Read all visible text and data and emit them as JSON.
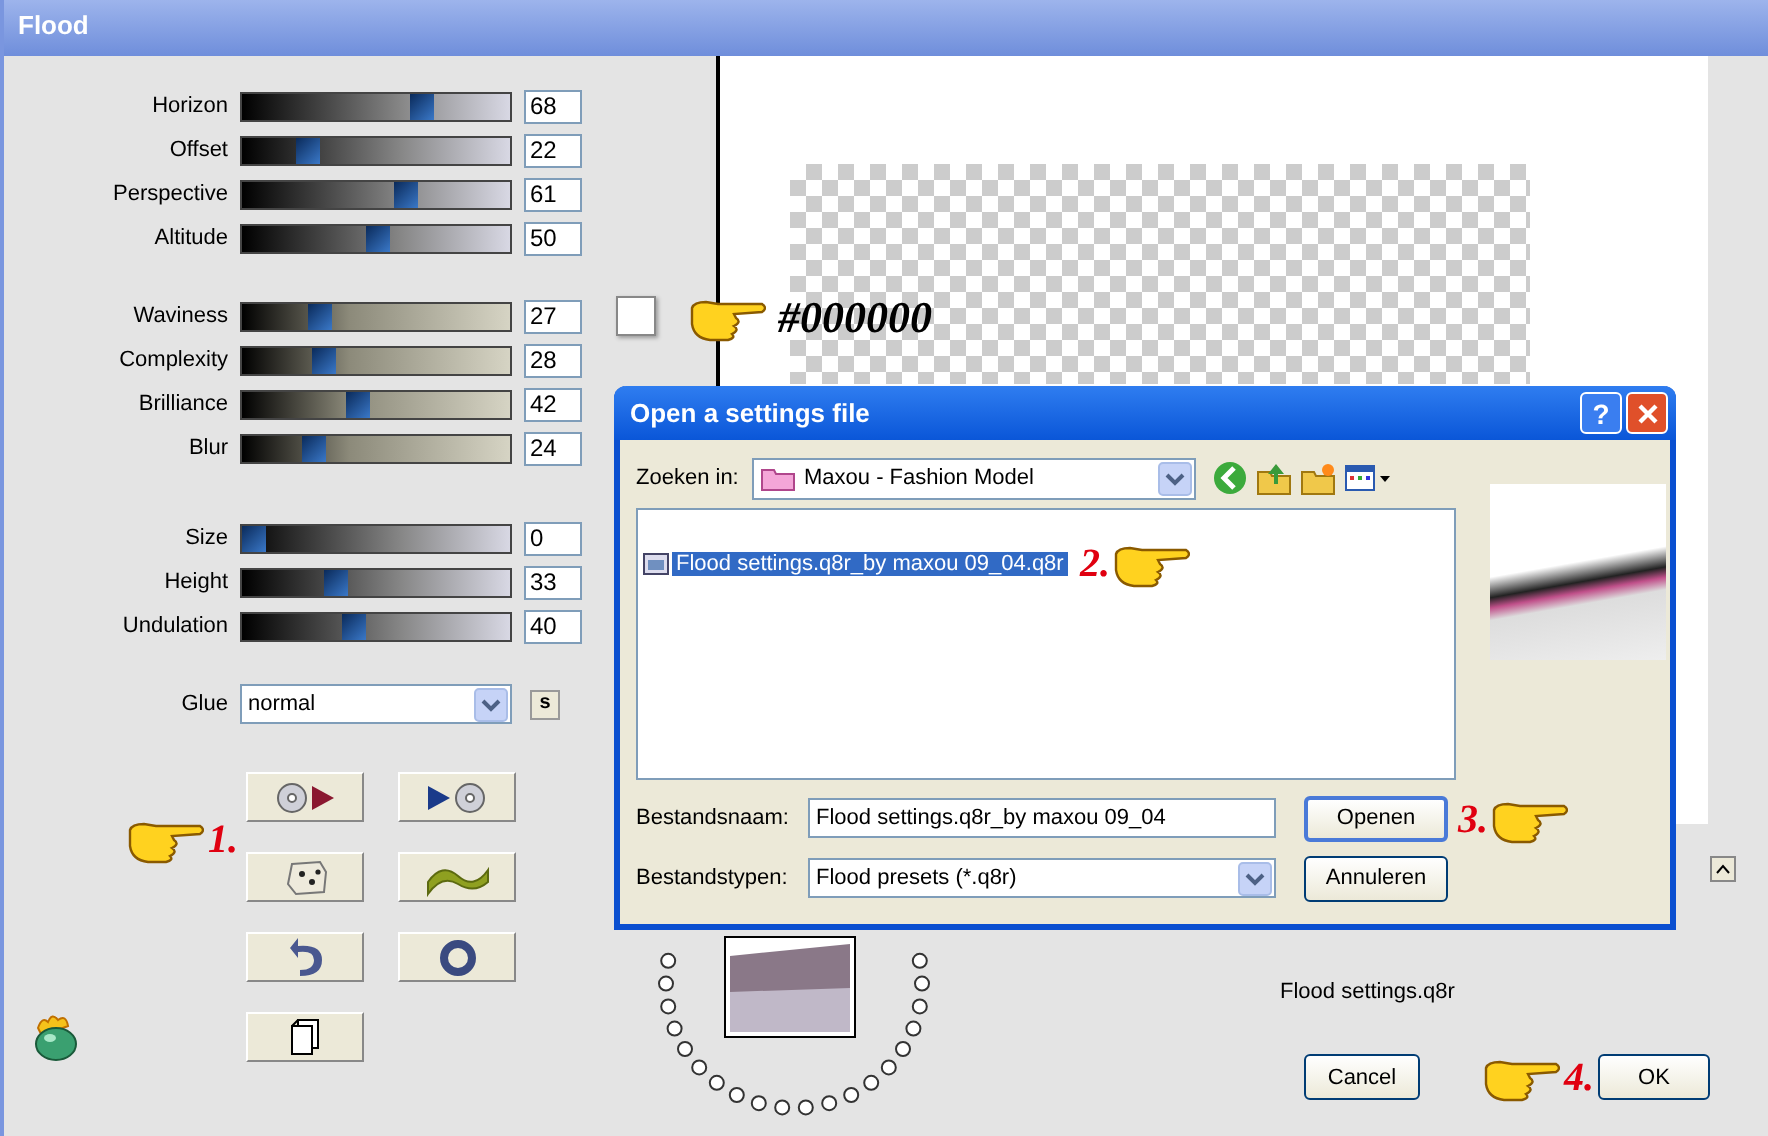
{
  "window": {
    "title": "Flood"
  },
  "slider_groups": [
    {
      "sliders": [
        {
          "label": "Horizon",
          "value": "68",
          "level": 0.68
        },
        {
          "label": "Offset",
          "value": "22",
          "level": 0.22
        },
        {
          "label": "Perspective",
          "value": "61",
          "level": 0.61
        },
        {
          "label": "Altitude",
          "value": "50",
          "level": 0.5
        }
      ]
    },
    {
      "sliders": [
        {
          "label": "Waviness",
          "value": "27",
          "level": 0.27
        },
        {
          "label": "Complexity",
          "value": "28",
          "level": 0.28
        },
        {
          "label": "Brilliance",
          "value": "42",
          "level": 0.42
        },
        {
          "label": "Blur",
          "value": "24",
          "level": 0.24
        }
      ]
    },
    {
      "sliders": [
        {
          "label": "Size",
          "value": "0",
          "level": 0
        },
        {
          "label": "Height",
          "value": "33",
          "level": 0.33
        },
        {
          "label": "Undulation",
          "value": "40",
          "level": 0.4
        }
      ]
    }
  ],
  "glue": {
    "label": "Glue",
    "value": "normal",
    "button": "s"
  },
  "tool_buttons": [
    {
      "kind": "load"
    },
    {
      "kind": "save"
    },
    {
      "kind": "random"
    },
    {
      "kind": "wave"
    },
    {
      "kind": "undo"
    },
    {
      "kind": "reset"
    },
    {
      "kind": "copy"
    }
  ],
  "annotations": [
    {
      "text": "#000000",
      "kind": "color"
    },
    {
      "text": "1.",
      "kind": "step_after_hand"
    },
    {
      "text": "2.",
      "kind": "step_before_hand"
    },
    {
      "text": "3.",
      "kind": "step_before_hand"
    },
    {
      "text": "4.",
      "kind": "step_after_hand"
    }
  ],
  "preview_caption": "Flood settings.q8r",
  "buttons": [
    "Cancel",
    "OK"
  ],
  "dialog": {
    "title": "Open a settings file",
    "help": "?",
    "look_in_label": "Zoeken in:",
    "look_in_value": "Maxou - Fashion Model",
    "files": [
      {
        "name": "Flood settings.q8r_by maxou 09_04.q8r",
        "selected": true
      }
    ],
    "filename_label": "Bestandsnaam:",
    "filename_value": "Flood settings.q8r_by maxou 09_04",
    "filetype_label": "Bestandstypen:",
    "filetype_value": "Flood presets (*.q8r)",
    "buttons": [
      "Openen",
      "Annuleren"
    ]
  }
}
